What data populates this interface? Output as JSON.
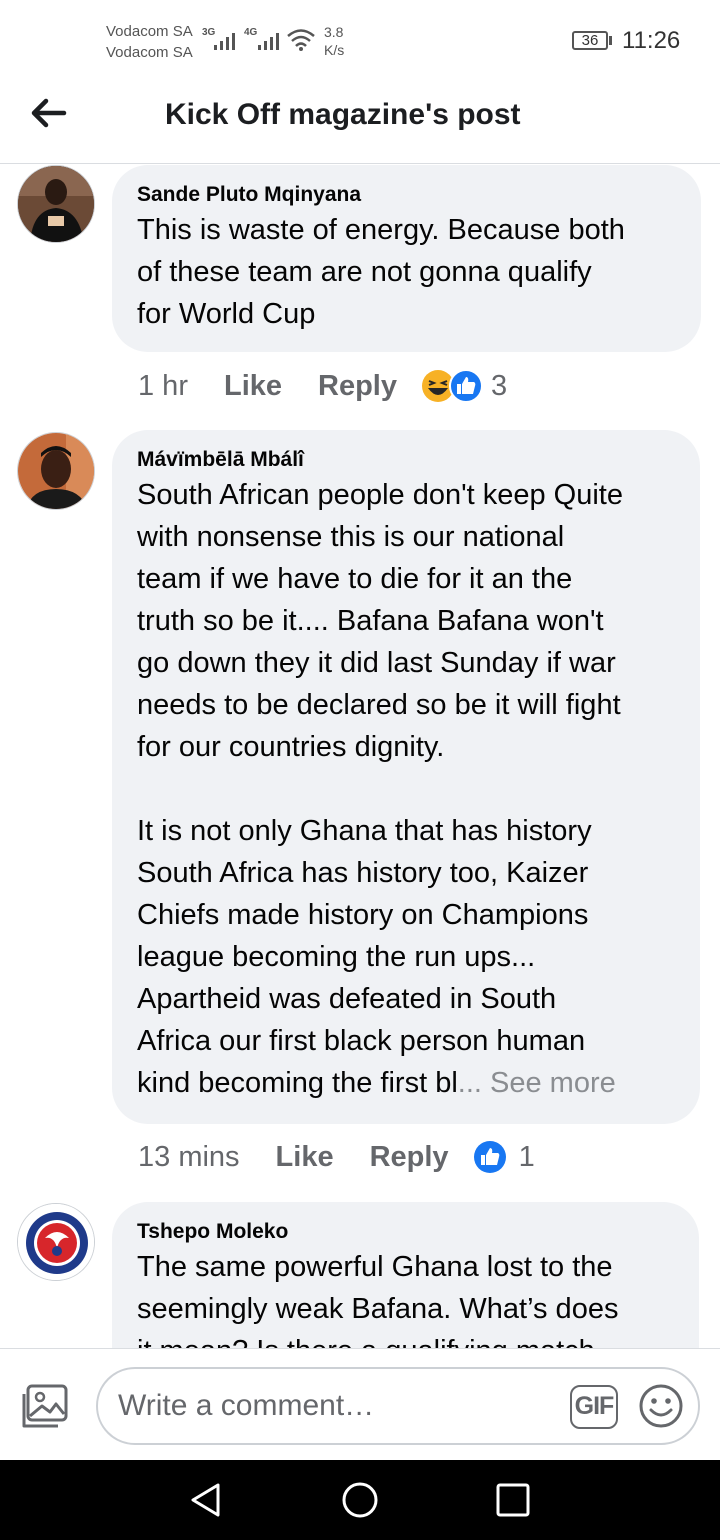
{
  "status_bar": {
    "carrier_1": "Vodacom SA",
    "carrier_2": "Vodacom SA",
    "network_1": "3G",
    "network_2": "4G",
    "speed_value": "3.8",
    "speed_unit": "K/s",
    "battery": "36",
    "time": "11:26"
  },
  "header": {
    "back_icon": "arrow-left-icon",
    "title": "Kick Off magazine's post"
  },
  "comments": [
    {
      "author": "Sande Pluto Mqinyana",
      "text": "This is waste of energy. Because both\nof these team are not gonna qualify\nfor World Cup",
      "time": "1 hr",
      "like_label": "Like",
      "reply_label": "Reply",
      "reactions": [
        "haha",
        "like"
      ],
      "reaction_count": "3"
    },
    {
      "author": "Mávïmbēlā Mbálî",
      "text": "South African people don't keep Quite\nwith nonsense this is our national\nteam if we have to die for it an the\ntruth so be it.... Bafana Bafana won't\ngo down they it did last Sunday if war\nneeds to be declared so be it will fight\nfor our countries dignity.\n\nIt is not only Ghana that has history\nSouth Africa has history too, Kaizer\nChiefs made history on Champions\nleague becoming the run ups...\nApartheid was defeated in South\nAfrica our first black person human\nkind becoming the first bl",
      "see_more": "... See more",
      "time": "13 mins",
      "like_label": "Like",
      "reply_label": "Reply",
      "reactions": [
        "like"
      ],
      "reaction_count": "1"
    },
    {
      "author": "Tshepo Moleko",
      "text": "The same powerful Ghana lost to the\nseemingly weak Bafana. What’s does\nit mean? Is there a qualifying match",
      "avatar_badge": "RED TAILED HAWKS FC"
    }
  ],
  "composer": {
    "photo_icon": "photo-icon",
    "placeholder": "Write a comment…",
    "gif_label": "GIF",
    "emoji_icon": "smiley-icon"
  },
  "colors": {
    "bubble": "#f0f2f5",
    "text": "#050505",
    "secondary": "#65676b",
    "like_blue": "#1877f2",
    "haha_yellow": "#f7b125"
  }
}
